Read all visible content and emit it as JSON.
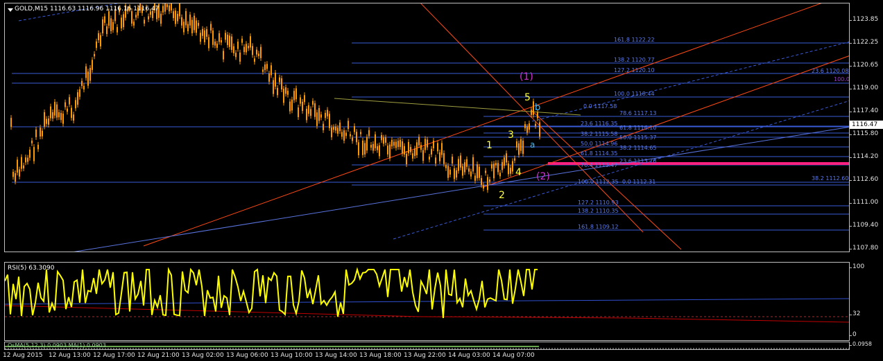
{
  "header": {
    "symbol_label": "GOLD,M15",
    "ohlc": "1116.63 1116.96 1116.16 1116.47"
  },
  "rsi": {
    "label": "RSI(5) 63.3090",
    "levels": [
      "100",
      "32",
      "0"
    ]
  },
  "osma": {
    "label": "OsMA(5,12,3) 0.0903  MA(1) 0.0903",
    "levels": [
      "0.0958",
      "0.0903"
    ]
  },
  "price_axis": [
    "1123.85",
    "1122.25",
    "1120.65",
    "1119.00",
    "1117.40",
    "1115.80",
    "1114.20",
    "1112.60",
    "1111.00",
    "1109.40",
    "1107.80"
  ],
  "current_price": "1116.47",
  "time_axis": [
    "12 Aug 2015",
    "12 Aug 13:00",
    "12 Aug 17:00",
    "12 Aug 21:00",
    "13 Aug 02:00",
    "13 Aug 06:00",
    "13 Aug 10:00",
    "13 Aug 14:00",
    "13 Aug 18:00",
    "13 Aug 22:00",
    "14 Aug 03:00",
    "14 Aug 07:00"
  ],
  "fib_labels": [
    "161.8 1122.22",
    "138.2 1120.77",
    "127.2 1120.10",
    "100.0 1118.44",
    "0.0 1117.58",
    "78.6 1117.13",
    "23.6 1116.35",
    "61.8 1116.10",
    "38.2 1115.58",
    "50.0 1115.37",
    "50.0 1114.96",
    "38.2 1114.65",
    "61.8 1114.35",
    "23.6 1113.76",
    "76.4 1113.47",
    "100.0 1112.35",
    "0.0 1112.31",
    "127.2 1110.93",
    "138.2 1110.35",
    "161.8 1109.12",
    "23.6 1120.08",
    "100.0",
    "38.2 1112.60"
  ],
  "waves": {
    "w1_big": "(1)",
    "w2_big": "(2)",
    "w1": "1",
    "w2": "2",
    "w3": "3",
    "w4": "4",
    "w5": "5",
    "wa": "a",
    "wb": "b"
  },
  "colors": {
    "candle": "#ff9900",
    "rsi": "#ffff00",
    "fib": "#3a5bd9",
    "trend": "#ff4a14",
    "magenta": "#ff2080"
  }
}
